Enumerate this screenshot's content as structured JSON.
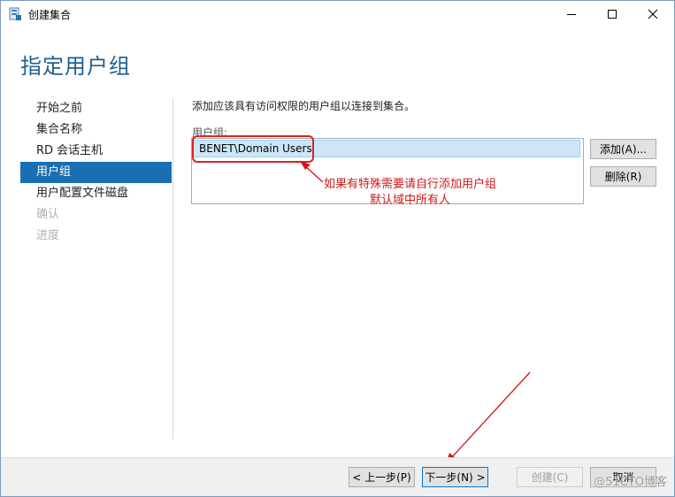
{
  "window": {
    "title": "创建集合",
    "icon": "server-manager-icon"
  },
  "page": {
    "title": "指定用户组",
    "description": "添加应该具有访问权限的用户组以连接到集合。"
  },
  "nav": {
    "items": [
      {
        "label": "开始之前",
        "state": "normal"
      },
      {
        "label": "集合名称",
        "state": "normal"
      },
      {
        "label": "RD 会话主机",
        "state": "normal"
      },
      {
        "label": "用户组",
        "state": "active"
      },
      {
        "label": "用户配置文件磁盘",
        "state": "normal"
      },
      {
        "label": "确认",
        "state": "disabled"
      },
      {
        "label": "进度",
        "state": "disabled"
      }
    ]
  },
  "groups": {
    "label": "用户组:",
    "items": [
      "BENET\\Domain Users"
    ]
  },
  "buttons": {
    "add": "添加(A)...",
    "remove": "删除(R)",
    "prev": "< 上一步(P)",
    "next": "下一步(N) >",
    "create": "创建(C)",
    "cancel": "取消"
  },
  "annotation": {
    "line1": "如果有特殊需要请自行添加用户组",
    "line2": "默认域中所有人"
  },
  "watermark": "@51CTO博客",
  "colors": {
    "accent": "#1a6fb3",
    "title": "#1f5f8f",
    "annotation": "#d01818"
  }
}
